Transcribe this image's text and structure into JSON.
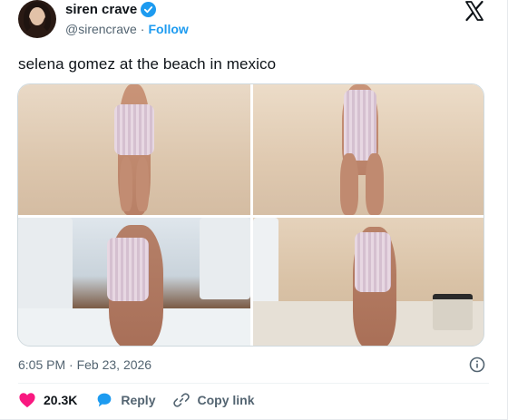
{
  "author": {
    "name": "siren crave",
    "handle": "@sirencrave",
    "separator": "·",
    "follow_label": "Follow"
  },
  "tweet": {
    "text": "selena gomez at the beach in mexico",
    "timestamp": "6:05 PM · Feb 23, 2026"
  },
  "media": {
    "count": 4
  },
  "actions": {
    "like_count": "20.3K",
    "reply_label": "Reply",
    "copy_link_label": "Copy link"
  },
  "colors": {
    "accent": "#1d9bf0",
    "like": "#f91880",
    "text": "#0f1419",
    "muted": "#536471"
  },
  "icons": [
    "verified-badge-icon",
    "x-logo-icon",
    "info-icon",
    "heart-icon",
    "reply-bubble-icon",
    "link-icon"
  ]
}
